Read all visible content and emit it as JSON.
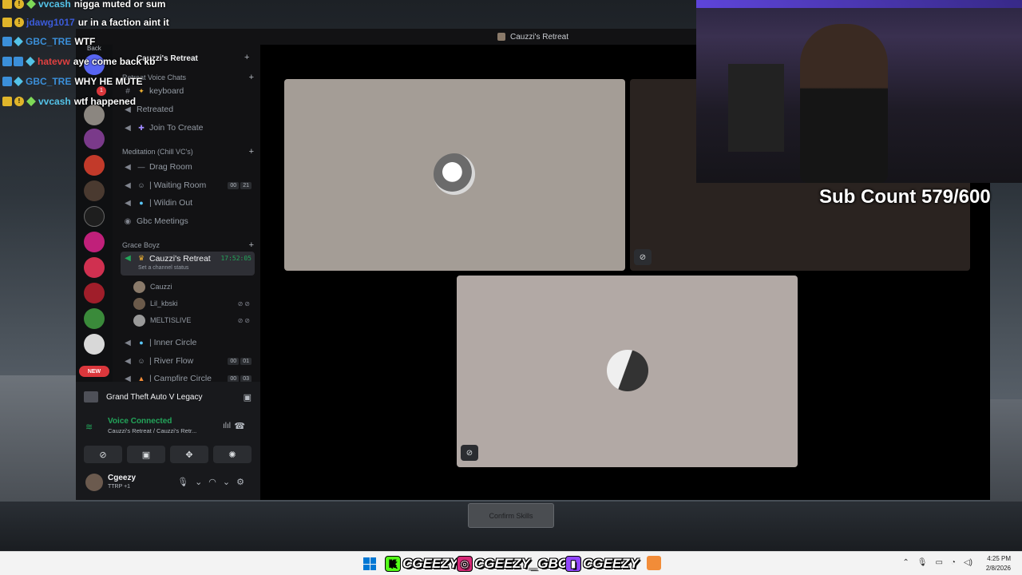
{
  "chat": [
    {
      "user": "vvcash",
      "color": "#54c3e8",
      "text": "nigga muted or sum"
    },
    {
      "user": "jdawg1017",
      "color": "#3b5bd9",
      "text": "ur in a faction aint it"
    },
    {
      "user": "GBC_TRE",
      "color": "#3b8fd9",
      "text": "WTF"
    },
    {
      "user": "hatevw",
      "color": "#e04040",
      "text": "aye come back kb"
    },
    {
      "user": "GBC_TRE",
      "color": "#3b8fd9",
      "text": "WHY HE MUTE"
    },
    {
      "user": "vvcash",
      "color": "#54c3e8",
      "text": "wtf happened"
    }
  ],
  "window": {
    "title": "Cauzzi's Retreat",
    "back_label": "Back"
  },
  "server": {
    "name": "Cauzzi's Retreat"
  },
  "categories": {
    "retreat": "Retreat Voice Chats",
    "meditation": "Meditation (Chill VC's)",
    "grace": "Grace Boyz"
  },
  "channels": {
    "keyboard": "keyboard",
    "retreated": "Retreated",
    "join": "Join To Create",
    "drag": "Drag Room",
    "waiting": "| Waiting Room",
    "waiting_c1": "00",
    "waiting_c2": "21",
    "wildin": "| Wildin Out",
    "gbc": "Gbc Meetings",
    "active": "Cauzzi's Retreat",
    "active_timer": "17:52:05",
    "active_status": "Set a channel status",
    "inner": "| Inner Circle",
    "river": "| River Flow",
    "river_c1": "00",
    "river_c2": "01",
    "campfire": "| Campfire Circle",
    "campfire_c1": "00",
    "campfire_c2": "03"
  },
  "members": [
    "Cauzzi",
    "Lil_kbski",
    "MELTISLIVE"
  ],
  "server_rail": {
    "new_badge": "NEW",
    "notif": "1"
  },
  "activity": {
    "game": "Grand Theft Auto V Legacy"
  },
  "voice": {
    "status": "Voice Connected",
    "channel": "Cauzzi's Retreat / Cauzzi's Retr..."
  },
  "user": {
    "name": "Cgeezy",
    "status": "TTRP +1"
  },
  "confirm_label": "Confirm Skills",
  "stream": {
    "sub_count": "Sub Count 579/600"
  },
  "taskbar": {
    "kick": "CGEEZY",
    "instagram": "CGEEZY_GBC",
    "twitch": "CGEEZY",
    "time": "4:25 PM",
    "date": "2/8/2026"
  }
}
